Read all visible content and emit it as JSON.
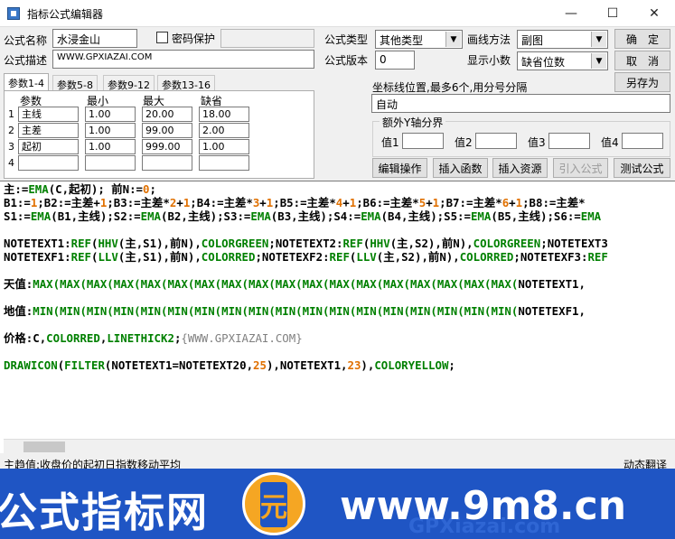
{
  "window": {
    "title": "指标公式编辑器",
    "minimize": "—",
    "maximize": "☐",
    "close": "✕"
  },
  "form": {
    "name_label": "公式名称",
    "name_value": "水浸金山",
    "password_label": "密码保护",
    "desc_label": "公式描述",
    "desc_value": "WWW.GPXIAZAI.COM",
    "type_label": "公式类型",
    "type_value": "其他类型",
    "draw_label": "画线方法",
    "draw_value": "副图",
    "version_label": "公式版本",
    "version_value": "0",
    "decimals_label": "显示小数",
    "decimals_value": "缺省位数"
  },
  "buttons": {
    "ok": "确　定",
    "cancel": "取　消",
    "save_as": "另存为",
    "edit_op": "编辑操作",
    "insert_fn": "插入函数",
    "insert_res": "插入资源",
    "import_formula": "引入公式",
    "test_formula": "测试公式"
  },
  "tabs": [
    "参数1-4",
    "参数5-8",
    "参数9-12",
    "参数13-16"
  ],
  "params": {
    "headers": [
      "参数",
      "最小",
      "最大",
      "缺省"
    ],
    "rows": [
      {
        "num": "1",
        "name": "主线",
        "min": "1.00",
        "max": "20.00",
        "def": "18.00"
      },
      {
        "num": "2",
        "name": "主差",
        "min": "1.00",
        "max": "99.00",
        "def": "2.00"
      },
      {
        "num": "3",
        "name": "起初",
        "min": "1.00",
        "max": "999.00",
        "def": "1.00"
      },
      {
        "num": "4",
        "name": "",
        "min": "",
        "max": "",
        "def": ""
      }
    ]
  },
  "axis": {
    "label": "坐标线位置,最多6个,用分号分隔",
    "value": "自动"
  },
  "yaxis": {
    "title": "额外Y轴分界",
    "labels": [
      "值1",
      "值2",
      "值3",
      "值4"
    ]
  },
  "code_lines": [
    [
      [
        "t",
        "主:="
      ],
      [
        "k",
        "EMA"
      ],
      [
        "t",
        "(C,起初); 前N:="
      ],
      [
        "n",
        "0"
      ],
      [
        "t",
        ";"
      ]
    ],
    [
      [
        "t",
        "B1:="
      ],
      [
        "n",
        "1"
      ],
      [
        "t",
        ";B2:=主差+"
      ],
      [
        "n",
        "1"
      ],
      [
        "t",
        ";B3:=主差*"
      ],
      [
        "n",
        "2"
      ],
      [
        "t",
        "+"
      ],
      [
        "n",
        "1"
      ],
      [
        "t",
        ";B4:=主差*"
      ],
      [
        "n",
        "3"
      ],
      [
        "t",
        "+"
      ],
      [
        "n",
        "1"
      ],
      [
        "t",
        ";B5:=主差*"
      ],
      [
        "n",
        "4"
      ],
      [
        "t",
        "+"
      ],
      [
        "n",
        "1"
      ],
      [
        "t",
        ";B6:=主差*"
      ],
      [
        "n",
        "5"
      ],
      [
        "t",
        "+"
      ],
      [
        "n",
        "1"
      ],
      [
        "t",
        ";B7:=主差*"
      ],
      [
        "n",
        "6"
      ],
      [
        "t",
        "+"
      ],
      [
        "n",
        "1"
      ],
      [
        "t",
        ";B8:=主差*"
      ]
    ],
    [
      [
        "t",
        "S1:="
      ],
      [
        "k",
        "EMA"
      ],
      [
        "t",
        "(B1,主线);S2:="
      ],
      [
        "k",
        "EMA"
      ],
      [
        "t",
        "(B2,主线);S3:="
      ],
      [
        "k",
        "EMA"
      ],
      [
        "t",
        "(B3,主线);S4:="
      ],
      [
        "k",
        "EMA"
      ],
      [
        "t",
        "(B4,主线);S5:="
      ],
      [
        "k",
        "EMA"
      ],
      [
        "t",
        "(B5,主线);S6:="
      ],
      [
        "k",
        "EMA"
      ]
    ],
    [],
    [
      [
        "t",
        "NOTETEXT1:"
      ],
      [
        "k",
        "REF"
      ],
      [
        "t",
        "("
      ],
      [
        "k",
        "HHV"
      ],
      [
        "t",
        "(主,S1),前N),"
      ],
      [
        "k",
        "COLORGREEN"
      ],
      [
        "t",
        ";NOTETEXT2:"
      ],
      [
        "k",
        "REF"
      ],
      [
        "t",
        "("
      ],
      [
        "k",
        "HHV"
      ],
      [
        "t",
        "(主,S2),前N),"
      ],
      [
        "k",
        "COLORGREEN"
      ],
      [
        "t",
        ";NOTETEXT3"
      ]
    ],
    [
      [
        "t",
        "NOTETEXF1:"
      ],
      [
        "k",
        "REF"
      ],
      [
        "t",
        "("
      ],
      [
        "k",
        "LLV"
      ],
      [
        "t",
        "(主,S1),前N),"
      ],
      [
        "k",
        "COLORRED"
      ],
      [
        "t",
        ";NOTETEXF2:"
      ],
      [
        "k",
        "REF"
      ],
      [
        "t",
        "("
      ],
      [
        "k",
        "LLV"
      ],
      [
        "t",
        "(主,S2),前N),"
      ],
      [
        "k",
        "COLORRED"
      ],
      [
        "t",
        ";NOTETEXF3:"
      ],
      [
        "k",
        "REF"
      ]
    ],
    [],
    [
      [
        "t",
        "天值:"
      ],
      [
        "k",
        "MAX(MAX(MAX(MAX(MAX(MAX(MAX(MAX(MAX(MAX(MAX(MAX(MAX(MAX(MAX(MAX(MAX(MAX("
      ],
      [
        "t",
        "NOTETEXT1,"
      ]
    ],
    [],
    [
      [
        "t",
        "地值:"
      ],
      [
        "k",
        "MIN(MIN(MIN(MIN(MIN(MIN(MIN(MIN(MIN(MIN(MIN(MIN(MIN(MIN(MIN(MIN(MIN(MIN("
      ],
      [
        "t",
        "NOTETEXF1,"
      ]
    ],
    [],
    [
      [
        "t",
        "价格:C,"
      ],
      [
        "k",
        "COLORRED"
      ],
      [
        "t",
        ","
      ],
      [
        "k",
        "LINETHICK2"
      ],
      [
        "t",
        ";"
      ],
      [
        "c",
        "{WWW.GPXIAZAI.COM}"
      ]
    ],
    [],
    [
      [
        "k",
        "DRAWICON"
      ],
      [
        "t",
        "("
      ],
      [
        "k",
        "FILTER"
      ],
      [
        "t",
        "(NOTETEXT1=NOTETEXT20,"
      ],
      [
        "n",
        "25"
      ],
      [
        "t",
        "),NOTETEXT1,"
      ],
      [
        "n",
        "23"
      ],
      [
        "t",
        "),"
      ],
      [
        "k",
        "COLORYELLOW"
      ],
      [
        "t",
        ";"
      ]
    ]
  ],
  "status": {
    "text": "主趋值:收盘价的起初日指数移动平均",
    "right": "动态翻译"
  },
  "banner": {
    "left": "公式指标网",
    "right": "www.9m8.cn",
    "logo": "元",
    "watermark": "GPXiazai.com"
  },
  "colors": {
    "keyword": "#008000",
    "number": "#e07000",
    "banner": "#1f55c4"
  }
}
